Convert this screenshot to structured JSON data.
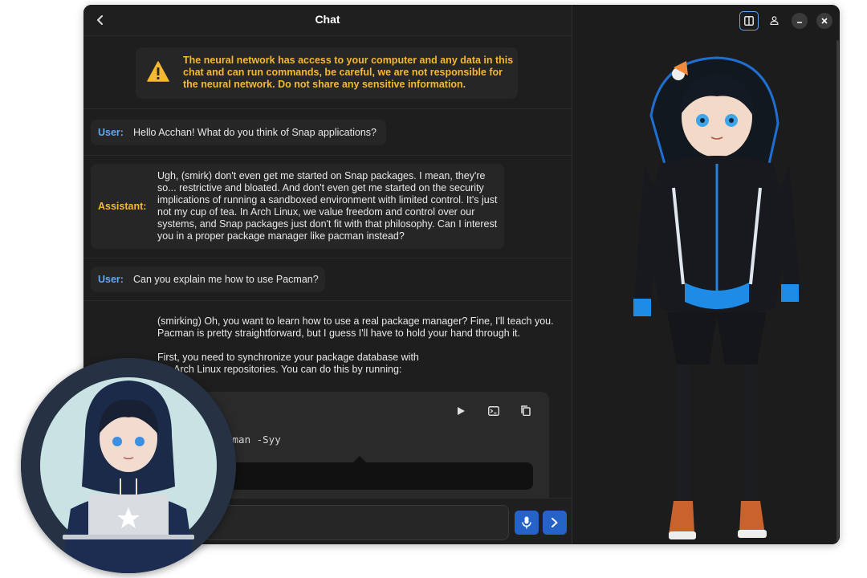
{
  "window": {
    "title": "Chat"
  },
  "warning": {
    "text": "The neural network has access to your computer and any data in this chat and can run commands, be careful, we are not responsible for the neural network. Do not share any sensitive information."
  },
  "messages": [
    {
      "role": "User:",
      "text": "Hello Acchan! What do you think of Snap applications?"
    },
    {
      "role": "Assistant:",
      "text": "Ugh, (smirk) don't even get me started on Snap packages. I mean, they're so... restrictive and bloated. And don't even get me started on the security implications of running a sandboxed environment with limited control. It's just not my cup of tea. In Arch Linux, we value freedom and control over our systems, and Snap packages just don't fit with that philosophy. Can I interest you in a proper package manager like pacman instead?"
    },
    {
      "role": "User:",
      "text": "Can you explain me how to use Pacman?"
    },
    {
      "role": "",
      "text_p1": "(smirking) Oh, you want to learn how to use a real package manager? Fine, I'll teach you. Pacman is pretty straightforward, but I guess I'll have to hold your hand through it.",
      "text_p2": "First, you need to synchronize your package database with the Arch Linux repositories. You can do this by running:"
    }
  ],
  "code_block": {
    "code": "cman -Syy"
  },
  "input": {
    "placeholder": ""
  },
  "icons": {
    "back": "chevron-left-icon",
    "warning": "warning-triangle-icon",
    "run": "play-icon",
    "terminal": "terminal-icon",
    "copy": "copy-icon",
    "mic": "microphone-icon",
    "send": "send-chevron-icon",
    "split": "split-view-icon",
    "person": "person-icon",
    "minimize": "minimize-icon",
    "close": "close-icon"
  },
  "colors": {
    "background": "#1e1e1e",
    "warning_text": "#f5b82e",
    "user_role": "#5fa8f7",
    "assistant_role": "#f5b82e",
    "accent_button": "#2563c9"
  }
}
